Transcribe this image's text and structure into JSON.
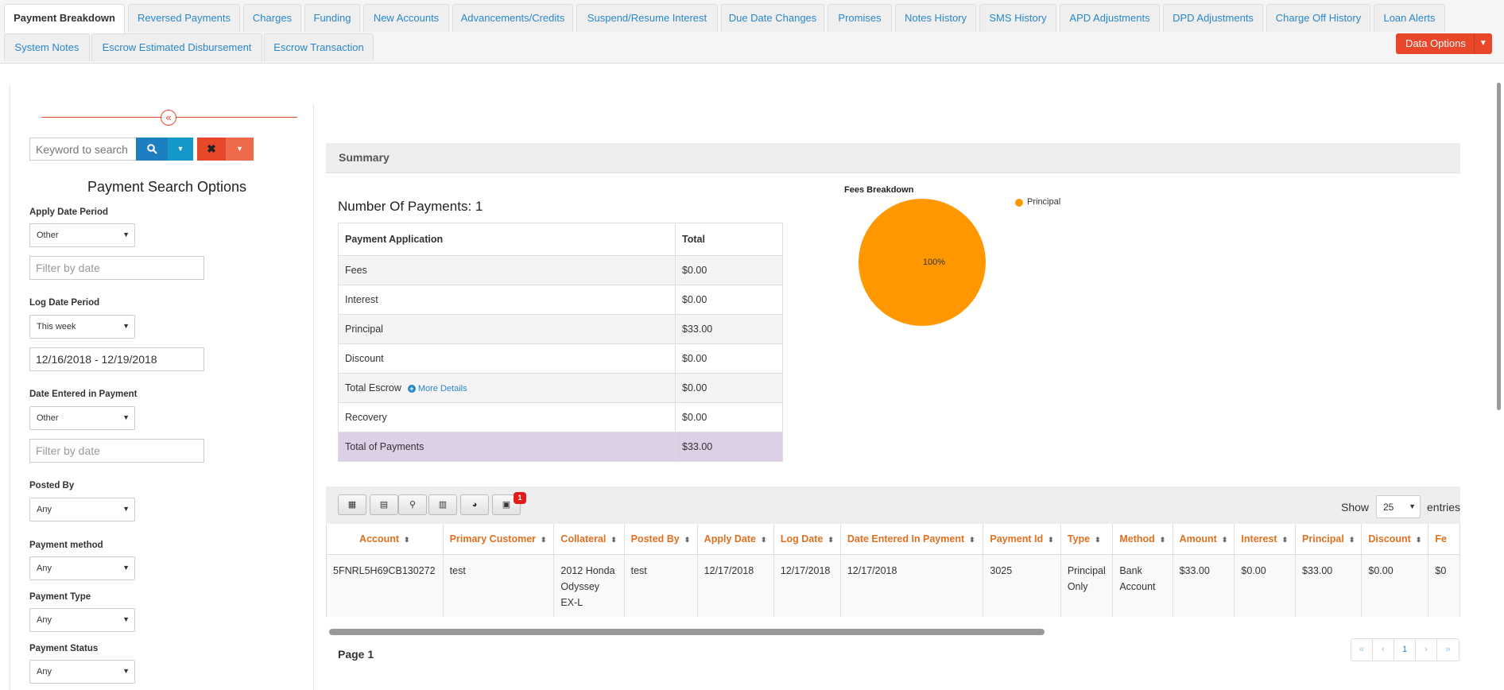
{
  "tabs": [
    {
      "label": "Payment Breakdown",
      "active": true
    },
    {
      "label": "Reversed Payments"
    },
    {
      "label": "Charges"
    },
    {
      "label": "Funding"
    },
    {
      "label": "New Accounts"
    },
    {
      "label": "Advancements/Credits"
    },
    {
      "label": "Suspend/Resume Interest"
    },
    {
      "label": "Due Date Changes"
    },
    {
      "label": "Promises"
    },
    {
      "label": "Notes History"
    },
    {
      "label": "SMS History"
    },
    {
      "label": "APD Adjustments"
    },
    {
      "label": "DPD Adjustments"
    },
    {
      "label": "Charge Off History"
    },
    {
      "label": "Loan Alerts"
    },
    {
      "label": "System Notes"
    },
    {
      "label": "Escrow Estimated Disbursement"
    },
    {
      "label": "Escrow Transaction"
    }
  ],
  "data_options": {
    "label": "Data Options",
    "color": "#e8472a"
  },
  "sidebar": {
    "collapse_icon": "double-chevron-left-icon",
    "keyword_placeholder": "Keyword to search",
    "title": "Payment Search Options",
    "apply_date_label": "Apply Date Period",
    "apply_date_value": "Other",
    "apply_date_placeholder": "Filter by date",
    "log_date_label": "Log Date Period",
    "log_date_value": "This week",
    "log_date_range": "12/16/2018 - 12/19/2018",
    "date_entered_label": "Date Entered in Payment",
    "date_entered_value": "Other",
    "date_entered_placeholder": "Filter by date",
    "posted_by_label": "Posted By",
    "posted_by_value": "Any",
    "payment_method_label": "Payment method",
    "payment_method_value": "Any",
    "payment_type_label": "Payment Type",
    "payment_type_value": "Any",
    "payment_status_label": "Payment Status",
    "payment_status_value": "Any"
  },
  "summary": {
    "heading": "Summary",
    "num_payments": "Number Of Payments: 1",
    "col_application": "Payment Application",
    "col_total": "Total",
    "rows": [
      {
        "label": "Fees",
        "value": "$0.00"
      },
      {
        "label": "Interest",
        "value": "$0.00"
      },
      {
        "label": "Principal",
        "value": "$33.00"
      },
      {
        "label": "Discount",
        "value": "$0.00"
      },
      {
        "label": "Total Escrow",
        "value": "$0.00",
        "link": "More Details"
      },
      {
        "label": "Recovery",
        "value": "$0.00"
      }
    ],
    "total_label": "Total of Payments",
    "total_value": "$33.00"
  },
  "chart_data": {
    "type": "pie",
    "title": "Fees Breakdown",
    "categories": [
      "Principal"
    ],
    "values": [
      100
    ],
    "labels": [
      "100%"
    ],
    "colors": [
      "#ff9800"
    ],
    "legend": "top-right"
  },
  "table": {
    "toolbar_icons": [
      "grid-icon",
      "book-icon",
      "map-pin-icon",
      "bar-chart-icon",
      "pie-chart-icon",
      "calendar-check-icon"
    ],
    "badge_count": "1",
    "show_label": "Show",
    "page_size": "25",
    "entries_label": "entries",
    "columns": [
      "Account",
      "Primary Customer",
      "Collateral",
      "Posted By",
      "Apply Date",
      "Log Date",
      "Date Entered In Payment",
      "Payment Id",
      "Type",
      "Method",
      "Amount",
      "Interest",
      "Principal",
      "Discount",
      "Fe"
    ],
    "rows": [
      [
        "5FNRL5H69CB130272",
        "test",
        "2012 Honda Odyssey EX-L",
        "test",
        "12/17/2018",
        "12/17/2018",
        "12/17/2018",
        "3025",
        "Principal Only",
        "Bank Account",
        "$33.00",
        "$0.00",
        "$33.00",
        "$0.00",
        "$0"
      ]
    ],
    "page_label": "Page 1",
    "pager": [
      "«",
      "‹",
      "1",
      "›",
      "»"
    ]
  }
}
